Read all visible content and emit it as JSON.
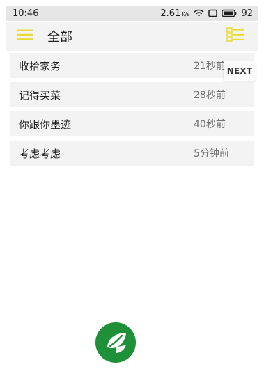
{
  "status_bar": {
    "time": "10:46",
    "network_speed": "2.61",
    "network_unit": "K/s",
    "battery": "92"
  },
  "toolbar": {
    "title": "全部"
  },
  "tasks": [
    {
      "title": "收拾家务",
      "time": "21秒前"
    },
    {
      "title": "记得买菜",
      "time": "28秒前"
    },
    {
      "title": "你跟你墨迹",
      "time": "40秒前"
    },
    {
      "title": "考虑考虑",
      "time": "5分钟前"
    }
  ],
  "next_button": {
    "label": "NEXT"
  },
  "colors": {
    "accent": "#e7dc2f",
    "logo_green": "#1e9138"
  },
  "icons": {
    "menu": "hamburger-menu-icon",
    "list_toggle": "list-view-icon",
    "wifi": "wifi-icon",
    "screen": "screen-icon",
    "battery": "battery-icon",
    "logo": "leaf-logo"
  }
}
